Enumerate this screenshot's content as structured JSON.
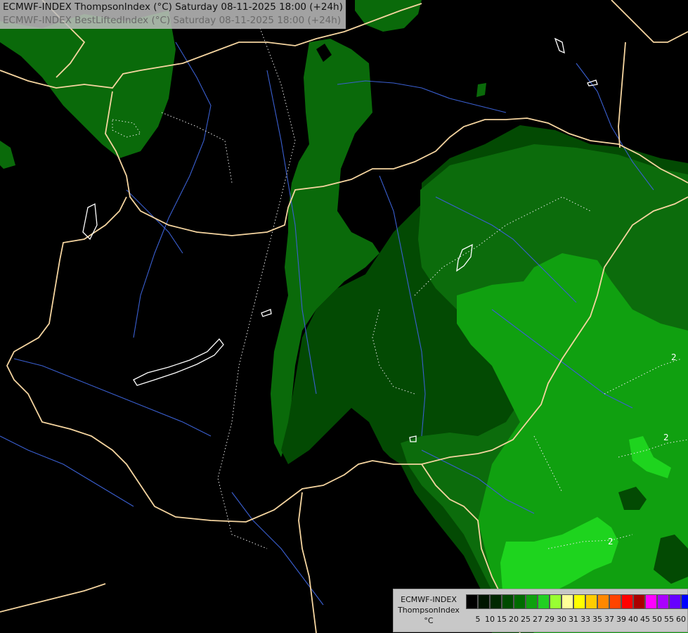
{
  "header": {
    "line1": "ECMWF-INDEX ThompsonIndex (°C) Saturday 08-11-2025 18:00 (+24h)",
    "line2": "ECMWF-INDEX BestLiftedIndex (°C) Saturday 08-11-2025 18:00 (+24h)"
  },
  "legend": {
    "model": "ECMWF-INDEX",
    "parameter": "ThompsonIndex",
    "unit": "°C",
    "classes": [
      {
        "label": "5",
        "color": "#000000"
      },
      {
        "label": "10",
        "color": "#001500"
      },
      {
        "label": "15",
        "color": "#002800"
      },
      {
        "label": "20",
        "color": "#004a00"
      },
      {
        "label": "25",
        "color": "#006b00"
      },
      {
        "label": "27",
        "color": "#0fa00f"
      },
      {
        "label": "29",
        "color": "#22d022"
      },
      {
        "label": "30",
        "color": "#99ff33"
      },
      {
        "label": "31",
        "color": "#ffff99"
      },
      {
        "label": "33",
        "color": "#ffff00"
      },
      {
        "label": "35",
        "color": "#ffcc00"
      },
      {
        "label": "37",
        "color": "#ff8800"
      },
      {
        "label": "39",
        "color": "#ff4400"
      },
      {
        "label": "40",
        "color": "#ff0000"
      },
      {
        "label": "45",
        "color": "#aa0000"
      },
      {
        "label": "50",
        "color": "#ff00ff"
      },
      {
        "label": "55",
        "color": "#aa00ff"
      },
      {
        "label": "60",
        "color": "#6600ff"
      }
    ],
    "last_color": "#0000ff"
  },
  "contour_labels": [
    {
      "text": "2"
    },
    {
      "text": "2"
    },
    {
      "text": "2"
    }
  ],
  "colors": {
    "background": "#000000",
    "border": "#f5d5a0",
    "river": "#3a5fd0",
    "lake": "#ffffff",
    "contour": "#e8e8e8"
  }
}
